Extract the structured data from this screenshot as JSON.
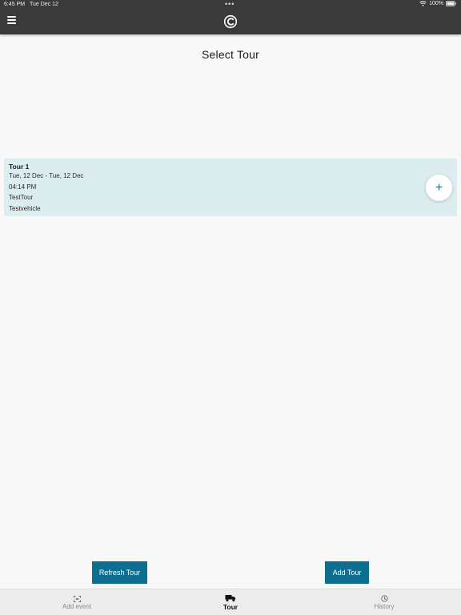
{
  "status_bar": {
    "time": "6:45 PM",
    "date": "Tue Dec 12",
    "multitask_dots": "•••",
    "battery": "100%"
  },
  "header": {
    "menu_icon": "hamburger-icon",
    "logo_icon": "app-logo-icon",
    "bar_color": "#3a3a3a"
  },
  "page": {
    "title": "Select Tour"
  },
  "tours": [
    {
      "name": "Tour 1",
      "dates": "Tue, 12 Dec - Tue, 12 Dec",
      "time": "04:14 PM",
      "description": "TestTour",
      "vehicle": "Testvehicle",
      "add_symbol": "+"
    }
  ],
  "actions": {
    "refresh_label": "Refresh Tour",
    "add_label": "Add Tour",
    "button_color": "#0d6f8f"
  },
  "tabbar": {
    "tabs": [
      {
        "label": "Add event",
        "icon": "scan-icon"
      },
      {
        "label": "Tour",
        "icon": "truck-icon",
        "active": true
      },
      {
        "label": "History",
        "icon": "clock-icon"
      }
    ]
  },
  "colors": {
    "card_background": "#dcedef",
    "accent": "#0d6f8f"
  }
}
